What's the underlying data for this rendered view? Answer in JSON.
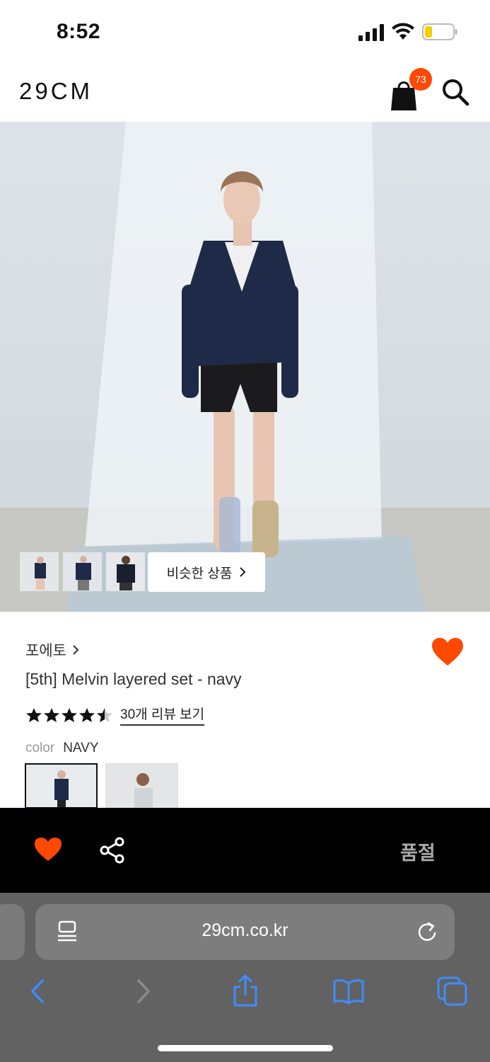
{
  "status_bar": {
    "time": "8:52"
  },
  "header": {
    "logo": "29CM",
    "cart_count": "73",
    "icons": [
      "shopping-bag-icon",
      "search-icon"
    ]
  },
  "hero": {
    "similar_button_label": "비슷한 상품",
    "thumbnail_count": 3
  },
  "product": {
    "brand": "포에토",
    "name": "[5th] Melvin layered set - navy",
    "rating": 4.5,
    "review_link": "30개 리뷰 보기",
    "color_label": "color",
    "color_value": "NAVY"
  },
  "action_bar": {
    "status_label": "품절",
    "icons": [
      "heart-icon",
      "share-icon"
    ]
  },
  "browser": {
    "url": "29cm.co.kr",
    "icons": [
      "reader-icon",
      "reload-icon",
      "back-icon",
      "forward-icon",
      "share-sheet-icon",
      "bookmarks-icon",
      "tabs-icon"
    ]
  },
  "colors": {
    "accent": "#ff4800",
    "action_bar": "#000000",
    "browser_bar": "#626262"
  }
}
